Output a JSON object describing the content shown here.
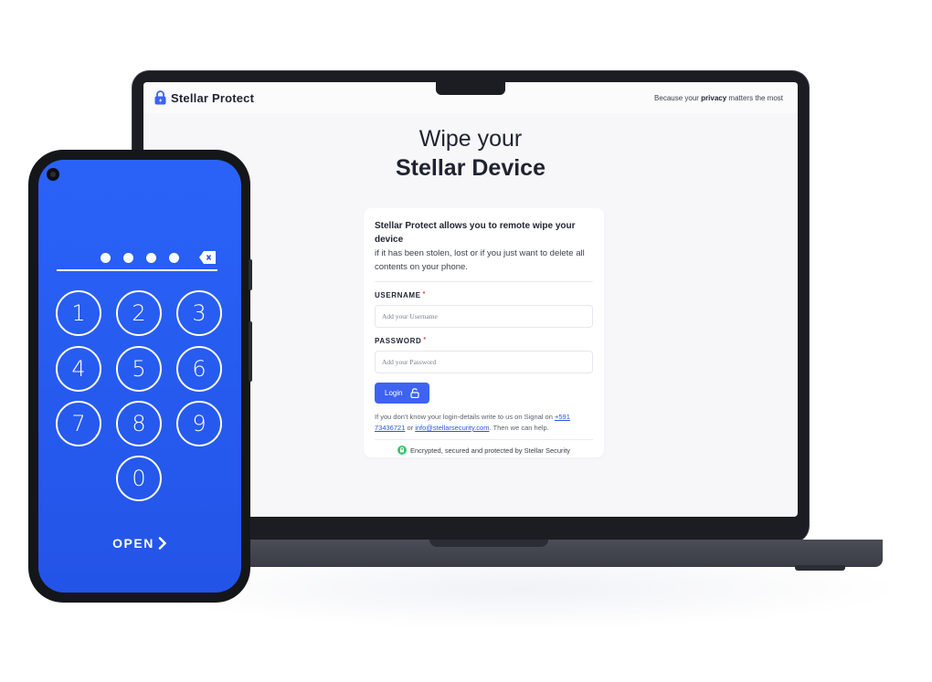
{
  "header": {
    "brand_name": "Stellar Protect",
    "tagline_prefix": "Because your ",
    "tagline_bold": "privacy",
    "tagline_suffix": " matters the most"
  },
  "hero": {
    "line1": "Wipe your",
    "line2": "Stellar Device"
  },
  "card": {
    "intro_bold": "Stellar Protect allows you to remote wipe your device",
    "intro_body": "if it has been stolen, lost or if you just want to delete all contents on your phone.",
    "username_label": "USERNAME",
    "username_placeholder": "Add your Username",
    "password_label": "PASSWORD",
    "password_placeholder": "Add your Password",
    "required_mark": "*",
    "login_label": "Login",
    "help_prefix": "If you don't know your login-details write to us on Signal on ",
    "help_phone": "+591 73436721",
    "help_or": " or ",
    "help_email": "info@stellarsecurity.com",
    "help_suffix": ". Then we can help.",
    "secure_text": "Encrypted, secured and protected by Stellar Security"
  },
  "phone": {
    "pin_dots_filled": 4,
    "keys": [
      "1",
      "2",
      "3",
      "4",
      "5",
      "6",
      "7",
      "8",
      "9",
      "0"
    ],
    "open_label": "OPEN"
  },
  "colors": {
    "accent": "#3d63f0",
    "phone_bg": "#2a62f8",
    "link": "#2c54e6",
    "required": "#e0474c",
    "secure_green": "#3ec46d"
  },
  "icons": {
    "brand": "padlock-icon",
    "login": "unlock-icon",
    "backspace": "backspace-icon",
    "open": "chevron-right-icon",
    "secure": "shield-icon"
  }
}
